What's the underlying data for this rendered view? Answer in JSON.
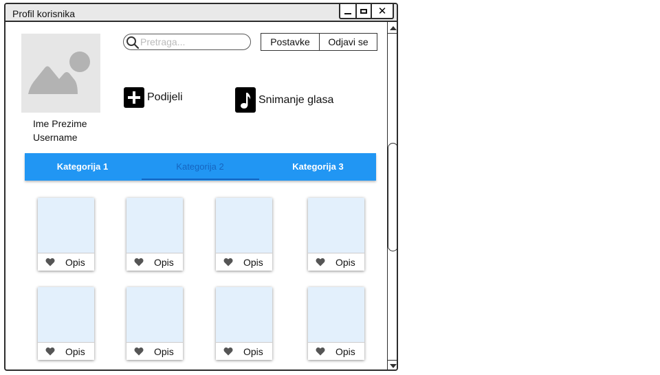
{
  "window": {
    "title": "Profil korisnika",
    "close_symbol": "✕"
  },
  "profile": {
    "name": "Ime Prezime",
    "username": "Username",
    "avatar_icon": "image-placeholder-icon"
  },
  "search": {
    "placeholder": "Pretraga...",
    "value": "",
    "icon": "search-icon"
  },
  "header_buttons": {
    "settings_label": "Postavke",
    "logout_label": "Odjavi se"
  },
  "actions": {
    "share_label": "Podijeli",
    "share_icon": "plus-icon",
    "record_label": "Snimanje glasa",
    "record_icon": "music-note-icon"
  },
  "tabs": [
    {
      "label": "Kategorija 1",
      "selected": false
    },
    {
      "label": "Kategorija 2",
      "selected": true
    },
    {
      "label": "Kategorija 3",
      "selected": false
    }
  ],
  "cards": [
    {
      "label": "Opis"
    },
    {
      "label": "Opis"
    },
    {
      "label": "Opis"
    },
    {
      "label": "Opis"
    },
    {
      "label": "Opis"
    },
    {
      "label": "Opis"
    },
    {
      "label": "Opis"
    },
    {
      "label": "Opis"
    }
  ],
  "colors": {
    "tab_bar": "#2196f3",
    "tab_selected": "#1565c0",
    "card_image": "#e3f0fc",
    "avatar_bg": "#e6e6e6",
    "icon_gray": "#b3b3b3"
  }
}
